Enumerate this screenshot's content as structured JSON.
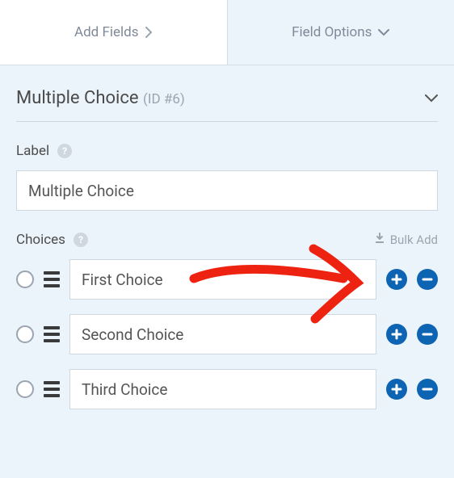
{
  "tabs": {
    "add_fields": "Add Fields",
    "field_options": "Field Options"
  },
  "panel": {
    "title": "Multiple Choice",
    "id_text": "(ID #6)"
  },
  "label_section": {
    "label": "Label",
    "value": "Multiple Choice"
  },
  "choices_section": {
    "label": "Choices",
    "bulk_add": "Bulk Add",
    "items": [
      {
        "value": "First Choice"
      },
      {
        "value": "Second Choice"
      },
      {
        "value": "Third Choice"
      }
    ]
  }
}
